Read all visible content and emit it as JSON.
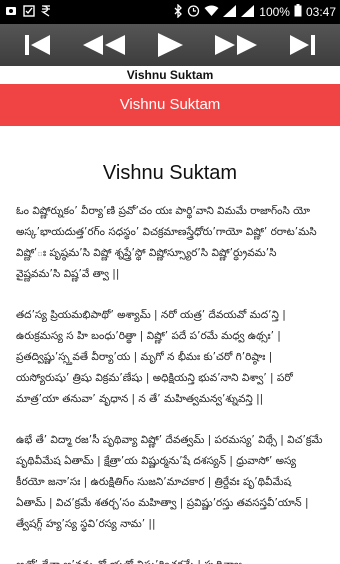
{
  "status_bar": {
    "left_icons": [
      "notification-icon",
      "checkbox-icon",
      "rupee-icon"
    ],
    "battery": "100%",
    "time": "03:47"
  },
  "player": {
    "buttons": [
      "skip-previous",
      "rewind",
      "play",
      "fast-forward",
      "skip-next"
    ]
  },
  "app_title": "Vishnu Suktam",
  "header_bar": {
    "title": "Vishnu Suktam"
  },
  "content": {
    "heading": "Vishnu Suktam",
    "paragraphs": [
      "ఓం విష్ణోర్నుకం’ వీర్యా’ణి ప్రవో’చం యః పార్థి’వాని విమమే రాజాగ్ంసి యో అస్క’భాయదుత్త’రగ్ం సధస్థం’ విచక్రమాణస్త్రేధోరు’గాయో విష్ణో’ రరాట’మసి విష్ణో’ః పృష్ఠమ’సి విష్ణో శ్నప్త్రే’స్థో విష్ణోస్స్యూర’సి విష్ణో’ర్ధ్రువమ’సి వైష్ణవమ’సి విష్ణ’వే త్వా ||",
      "తద’స్య ప్రియమభిపాథో’ అశ్యామ్ | నరో యత్ర’ దేవయవో మద’న్తి | ఉరుక్రమస్య స హి బంధు’రిత్థా | విష్ణో’ పదే ప’రమే మధ్వ ఉథ్సః’ | ప్రతద్విష్ణు’స్స్తవతే వీర్యా’య | మృగో న భీమః కు’చరో గి’రిష్ఠాః | యస్యోరుషు’ త్రిషు విక్రమ’ణేషు | అధిక్షియన్తి భువ’నాని విశ్వా’ | పరో మాత్ర’యా తనువా’ వృధాన | న తే’ మహిత్వమన్వ’శ్నువన్తి ||",
      "ఉభే తే’ విద్మా రజ’సీ పృథివ్యా విష్ణో’ దేవత్వమ్ | పరమస్య’ విథ్సే | విచ’క్రమే పృథివీమేష ఏతామ్ | క్షేత్రా’య విష్ణుర్మను’షే దశస్యన్ | ధ్రువాసో’ అస్య కీరయో జనా’సః | ఉరుక్షితిగ్ం సుజని’మాచకార | త్రిర్దేవః పృ’థివీమేష ఏతామ్ | విచ’క్రమే శతర్చ’సం మహిత్వా | ప్రవిష్ణు’రస్తు తవసస్తవీ’యాన్ | త్వేషగ్గ్ హ్య’స్య స్థవి’రస్య నామ’ ||",
      "అతో’ దేవా అ’వన్తు నో యతో విష్ణు’ర్విచక్రమే | పృథివ్యాః"
    ]
  }
}
